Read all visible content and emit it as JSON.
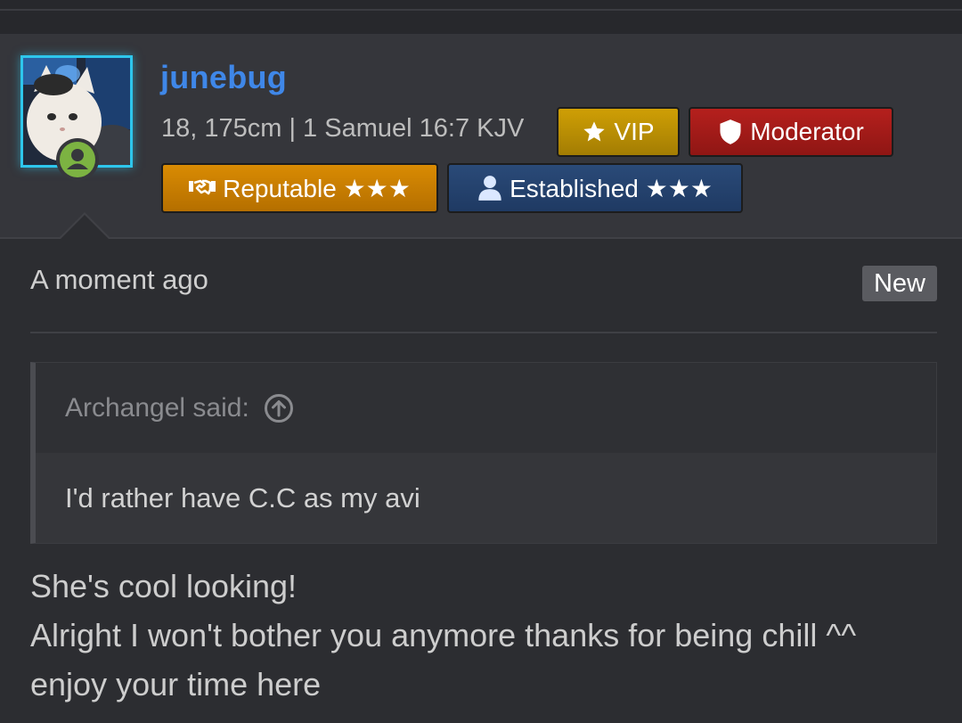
{
  "user": {
    "username": "junebug",
    "title": "18, 175cm | 1 Samuel 16:7 KJV",
    "avatar_icon": "cat-avatar",
    "online_icon": "user-online-icon",
    "online_color": "#7cb342",
    "badges": [
      {
        "label": "VIP",
        "icon": "star-icon",
        "color": "#c49705"
      },
      {
        "label": "Moderator",
        "icon": "shield-icon",
        "color": "#a81c1a"
      },
      {
        "label": "Reputable ★★★",
        "icon": "handshake-icon",
        "color": "#cf8402"
      },
      {
        "label": "Established ★★★",
        "icon": "user-icon",
        "color": "#264573"
      }
    ]
  },
  "post": {
    "time": "A moment ago",
    "new_label": "New",
    "quote": {
      "author_line": "Archangel said:",
      "jump_icon": "arrow-up-circle-icon",
      "text": "I'd rather have C.C as my avi"
    },
    "message_lines": [
      "She's cool looking!",
      "Alright I won't bother you anymore thanks for being chill ^^",
      "enjoy your time here"
    ]
  },
  "colors": {
    "background": "#2c2d31",
    "username": "#3f87e8",
    "avatar_border": "#2ec6ec"
  }
}
